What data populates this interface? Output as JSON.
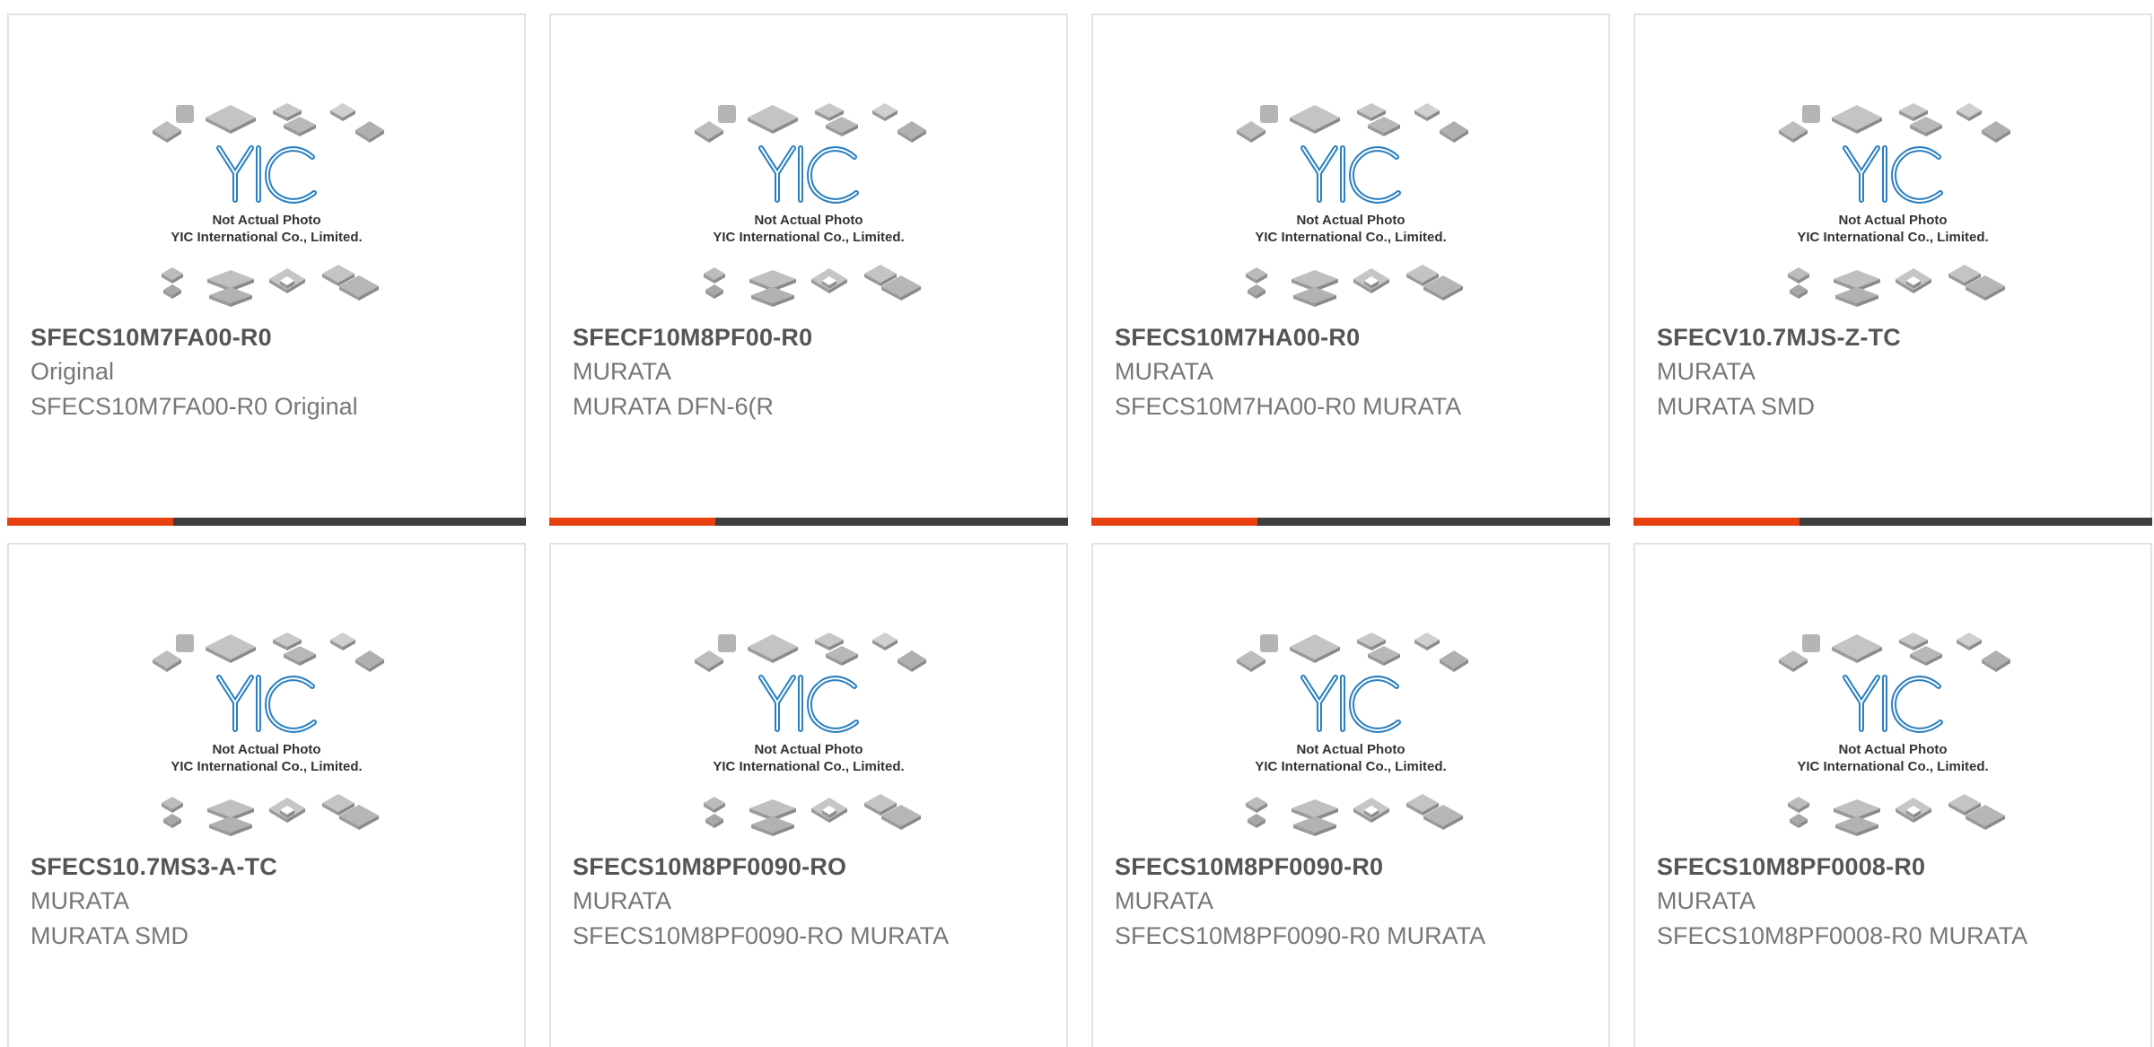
{
  "placeholder": {
    "line1": "Not Actual Photo",
    "line2": "YIC International Co., Limited.",
    "logo_text": "YIC"
  },
  "colors": {
    "accent": "#e8410f",
    "bar": "#3d3d3d",
    "logo": "#2a7fc1",
    "title": "#555555",
    "text": "#777777"
  },
  "products": [
    {
      "part": "SFECS10M7FA00-R0",
      "maker": "Original",
      "description": "SFECS10M7FA00-R0 Original",
      "progress": 0.32
    },
    {
      "part": "SFECF10M8PF00-R0",
      "maker": "MURATA",
      "description": "MURATA DFN-6(R",
      "progress": 0.32
    },
    {
      "part": "SFECS10M7HA00-R0",
      "maker": "MURATA",
      "description": "SFECS10M7HA00-R0 MURATA",
      "progress": 0.32
    },
    {
      "part": "SFECV10.7MJS-Z-TC",
      "maker": "MURATA",
      "description": "MURATA SMD",
      "progress": 0.32
    },
    {
      "part": "SFECS10.7MS3-A-TC",
      "maker": "MURATA",
      "description": "MURATA SMD"
    },
    {
      "part": "SFECS10M8PF0090-RO",
      "maker": "MURATA",
      "description": "SFECS10M8PF0090-RO MURATA"
    },
    {
      "part": "SFECS10M8PF0090-R0",
      "maker": "MURATA",
      "description": "SFECS10M8PF0090-R0 MURATA"
    },
    {
      "part": "SFECS10M8PF0008-R0",
      "maker": "MURATA",
      "description": "SFECS10M8PF0008-R0 MURATA"
    }
  ]
}
